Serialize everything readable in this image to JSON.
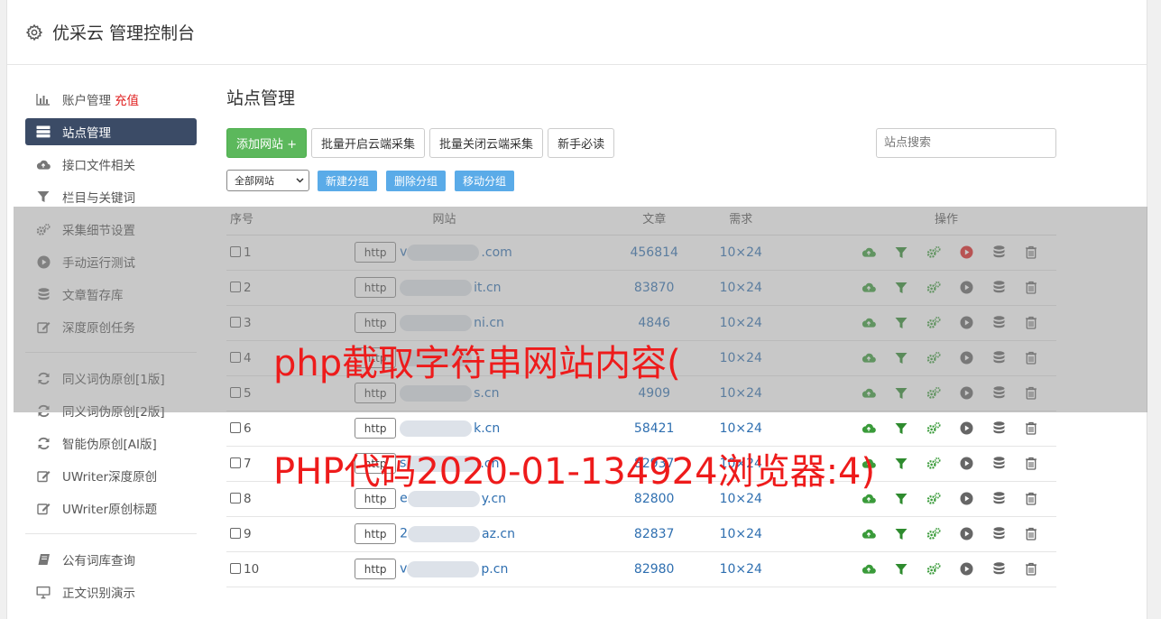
{
  "app": {
    "title": "优采云 管理控制台"
  },
  "sidebar": {
    "groups": [
      [
        {
          "label": "账户管理",
          "extra": "充值",
          "icon": "bar-chart-icon",
          "active": false
        },
        {
          "label": "站点管理",
          "icon": "server-icon",
          "active": true
        },
        {
          "label": "接口文件相关",
          "icon": "cloud-upload-icon",
          "active": false
        },
        {
          "label": "栏目与关键词",
          "icon": "filter-icon",
          "active": false
        },
        {
          "label": "采集细节设置",
          "icon": "gears-icon",
          "active": false
        },
        {
          "label": "手动运行测试",
          "icon": "play-circle-icon",
          "active": false
        },
        {
          "label": "文章暂存库",
          "icon": "database-icon",
          "active": false
        },
        {
          "label": "深度原创任务",
          "icon": "edit-icon",
          "active": false
        }
      ],
      [
        {
          "label": "同义词伪原创[1版]",
          "icon": "refresh-icon",
          "active": false
        },
        {
          "label": "同义词伪原创[2版]",
          "icon": "refresh-icon",
          "active": false
        },
        {
          "label": "智能伪原创[AI版]",
          "icon": "refresh-icon",
          "active": false
        },
        {
          "label": "UWriter深度原创",
          "icon": "edit-icon",
          "active": false
        },
        {
          "label": "UWriter原创标题",
          "icon": "edit-icon",
          "active": false
        }
      ],
      [
        {
          "label": "公有词库查询",
          "icon": "book-icon",
          "active": false
        },
        {
          "label": "正文识别演示",
          "icon": "monitor-icon",
          "active": false
        }
      ]
    ]
  },
  "main": {
    "title": "站点管理",
    "buttons": {
      "add": "添加网站 +",
      "batch_open": "批量开启云端采集",
      "batch_close": "批量关闭云端采集",
      "guide": "新手必读"
    },
    "search": {
      "placeholder": "站点搜索",
      "value": ""
    },
    "group_select": "全部网站",
    "group_buttons": [
      "新建分组",
      "删除分组",
      "移动分组"
    ],
    "table": {
      "headers": {
        "no": "序号",
        "site": "网站",
        "articles": "文章",
        "demand": "需求",
        "ops": "操作"
      },
      "rows": [
        {
          "no": "1",
          "proto": "http",
          "prefix": "v",
          "domain": ".com",
          "articles": "456814",
          "demand": "10×24",
          "running": true
        },
        {
          "no": "2",
          "proto": "http",
          "prefix": "",
          "domain": "it.cn",
          "articles": "83870",
          "demand": "10×24",
          "running": false
        },
        {
          "no": "3",
          "proto": "http",
          "prefix": "",
          "domain": "ni.cn",
          "articles": "4846",
          "demand": "10×24",
          "running": false
        },
        {
          "no": "4",
          "proto": "http",
          "prefix": "",
          "domain": "",
          "articles": "",
          "demand": "10×24",
          "running": false
        },
        {
          "no": "5",
          "proto": "http",
          "prefix": "",
          "domain": "s.cn",
          "articles": "4909",
          "demand": "10×24",
          "running": false
        },
        {
          "no": "6",
          "proto": "http",
          "prefix": "",
          "domain": "k.cn",
          "articles": "58421",
          "demand": "10×24",
          "running": false
        },
        {
          "no": "7",
          "proto": "http",
          "prefix": "s",
          "domain": ".cn",
          "articles": "82937",
          "demand": "10×24",
          "running": false
        },
        {
          "no": "8",
          "proto": "http",
          "prefix": "e",
          "domain": "y.cn",
          "articles": "82800",
          "demand": "10×24",
          "running": false
        },
        {
          "no": "9",
          "proto": "http",
          "prefix": "2",
          "domain": "az.cn",
          "articles": "82837",
          "demand": "10×24",
          "running": false
        },
        {
          "no": "10",
          "proto": "http",
          "prefix": "v",
          "domain": "p.cn",
          "articles": "82980",
          "demand": "10×24",
          "running": false
        }
      ]
    }
  },
  "overlay_caption": {
    "line1": "php截取字符串网站内容(",
    "line2": "PHP代码2020-01-134924浏览器:4)"
  },
  "colors": {
    "accent_green": "#5cb85c",
    "sidebar_active": "#3b4b66",
    "link_blue": "#2f6fb0",
    "caption_red": "#ee1b1b",
    "run_red": "#e02020"
  }
}
